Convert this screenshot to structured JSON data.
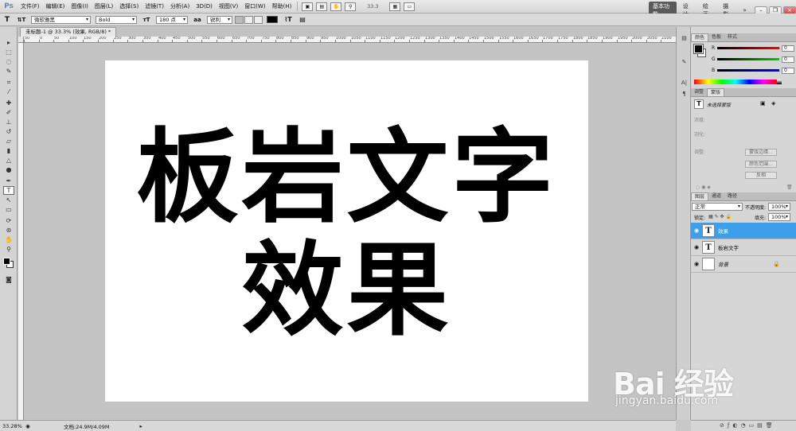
{
  "menubar": {
    "app_logo": "Ps",
    "items": [
      "文件(F)",
      "编辑(E)",
      "图像(I)",
      "图层(L)",
      "选择(S)",
      "滤镜(T)",
      "分析(A)",
      "3D(D)",
      "视图(V)",
      "窗口(W)",
      "帮助(H)"
    ],
    "zoom": "33.3",
    "workspaces": [
      "基本功能",
      "设计",
      "绘画",
      "摄影"
    ],
    "workspace_more": "»"
  },
  "options": {
    "font_family": "微软雅黑",
    "font_style": "Bold",
    "font_size": "180 点",
    "antialias": "锐利",
    "color": "#000000"
  },
  "document": {
    "tab_title": "未标题-1 @ 33.3% (效果, RGB/8) *",
    "line1": "板岩文字",
    "line2": "效果"
  },
  "ruler": {
    "top_labels": [
      "50",
      "0",
      "50",
      "100",
      "150",
      "200",
      "250",
      "300",
      "350",
      "400",
      "450",
      "500",
      "550",
      "600",
      "650",
      "700",
      "750",
      "800",
      "850",
      "900",
      "950",
      "1000",
      "1050",
      "1100",
      "1150",
      "1200",
      "1250",
      "1300",
      "1350",
      "1400",
      "1450",
      "1500",
      "1550",
      "1600",
      "1650",
      "1700",
      "1750",
      "1800",
      "1850",
      "1900",
      "1950",
      "2000",
      "2050",
      "2100"
    ]
  },
  "status": {
    "zoom": "33.28%",
    "doc_size": "文档:24.9M/4.09M"
  },
  "color_panel": {
    "tabs": [
      "颜色",
      "色板",
      "样式"
    ],
    "r_label": "R",
    "r_value": "0",
    "g_label": "G",
    "g_value": "0",
    "b_label": "B",
    "b_value": "0"
  },
  "masks_panel": {
    "tabs": [
      "调整",
      "蒙版"
    ],
    "title": "未选择蒙版",
    "density_label": "浓度:",
    "feather_label": "羽化:",
    "refine_label": "调整:",
    "edge_button": "蒙版边缘...",
    "color_range_button": "颜色范围...",
    "invert_button": "反相"
  },
  "layers_panel": {
    "tabs": [
      "图层",
      "通道",
      "路径"
    ],
    "blend_mode": "正常",
    "opacity_label": "不透明度:",
    "opacity_value": "100%",
    "lock_label": "锁定:",
    "fill_label": "填充:",
    "fill_value": "100%",
    "layers": [
      {
        "name": "效果",
        "thumb": "T",
        "selected": true
      },
      {
        "name": "板岩文字",
        "thumb": "T",
        "selected": false
      },
      {
        "name": "背景",
        "thumb": "",
        "selected": false
      }
    ]
  },
  "watermark": {
    "brand": "Bai 经验",
    "url": "jingyan.baidu.com"
  }
}
